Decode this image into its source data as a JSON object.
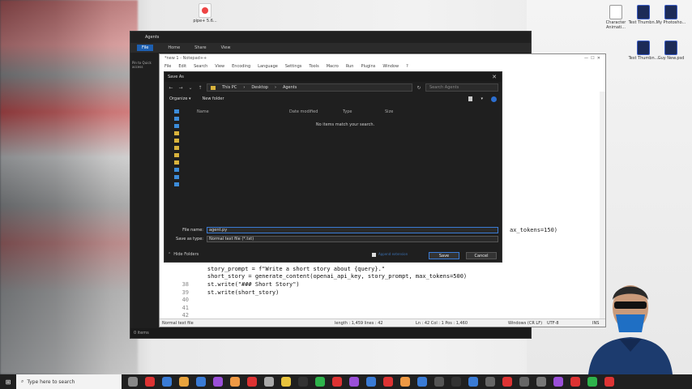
{
  "desktop": {
    "icons": [
      {
        "label": "Character Animati...",
        "color": "#ffffff"
      },
      {
        "label": "Test Thumbn...",
        "color": "#1c2b57"
      },
      {
        "label": "My Photosho...",
        "color": "#1c2b57"
      },
      {
        "label": "Test Thumbn...",
        "color": "#1c2b57"
      },
      {
        "label": "Guy New.psd",
        "color": "#1c2b57"
      },
      {
        "label": "pipe+ 5.6...",
        "color": "#e44"
      }
    ]
  },
  "explorer": {
    "title": "Agents",
    "ribbon": [
      "File",
      "Home",
      "Share",
      "View"
    ],
    "pin_label": "Pin to Quick access",
    "status": "0 items"
  },
  "notepad": {
    "title": "*new 1 - Notepad++",
    "menu": [
      "File",
      "Edit",
      "Search",
      "View",
      "Encoding",
      "Language",
      "Settings",
      "Tools",
      "Macro",
      "Run",
      "Plugins",
      "Window",
      "?"
    ],
    "fragment": "ax_tokens=150)",
    "code_lines": [
      {
        "num": "",
        "text": "    story_prompt = f\"Write a short story about {query}.\""
      },
      {
        "num": "",
        "text": "    short_story = generate_content(openai_api_key, story_prompt, max_tokens=500)"
      },
      {
        "num": "38",
        "text": "    st.write(\"### Short Story\")"
      },
      {
        "num": "39",
        "text": "    st.write(short_story)"
      },
      {
        "num": "40",
        "text": ""
      },
      {
        "num": "41",
        "text": ""
      },
      {
        "num": "42",
        "text": ""
      }
    ],
    "status": {
      "type": "Normal text file",
      "length": "length : 1,459    lines : 42",
      "pos": "Ln : 42    Col : 1    Pos : 1,460",
      "eol": "Windows (CR LF)",
      "enc": "UTF-8",
      "ins": "INS"
    }
  },
  "dialog": {
    "title": "Save As",
    "breadcrumb": [
      "This PC",
      "Desktop",
      "Agents"
    ],
    "search_placeholder": "Search Agents",
    "organize": "Organize ▾",
    "new_folder": "New folder",
    "columns": [
      "Name",
      "Date modified",
      "Type",
      "Size"
    ],
    "empty_message": "No items match your search.",
    "file_name_label": "File name:",
    "file_name_value": "agent.py",
    "save_type_label": "Save as type:",
    "save_type_value": "Normal text file (*.txt)",
    "hide_folders": "Hide Folders",
    "append_label": "Append extension",
    "save_label": "Save",
    "cancel_label": "Cancel"
  },
  "taskbar": {
    "search_placeholder": "Type here to search",
    "icon_colors": [
      "#888",
      "#d33",
      "#3a7bd5",
      "#e8a33d",
      "#3a7bd5",
      "#9a4fd8",
      "#e94",
      "#d33",
      "#aaa",
      "#e8c33d",
      "#333",
      "#2eb34b",
      "#d33",
      "#9a4fd8",
      "#3a7bd5",
      "#d33",
      "#e94",
      "#3a7bd5",
      "#555",
      "#333",
      "#3a7bd5",
      "#666",
      "#d33",
      "#666",
      "#777",
      "#9a4fd8",
      "#d33",
      "#2eb34b",
      "#d33"
    ]
  }
}
